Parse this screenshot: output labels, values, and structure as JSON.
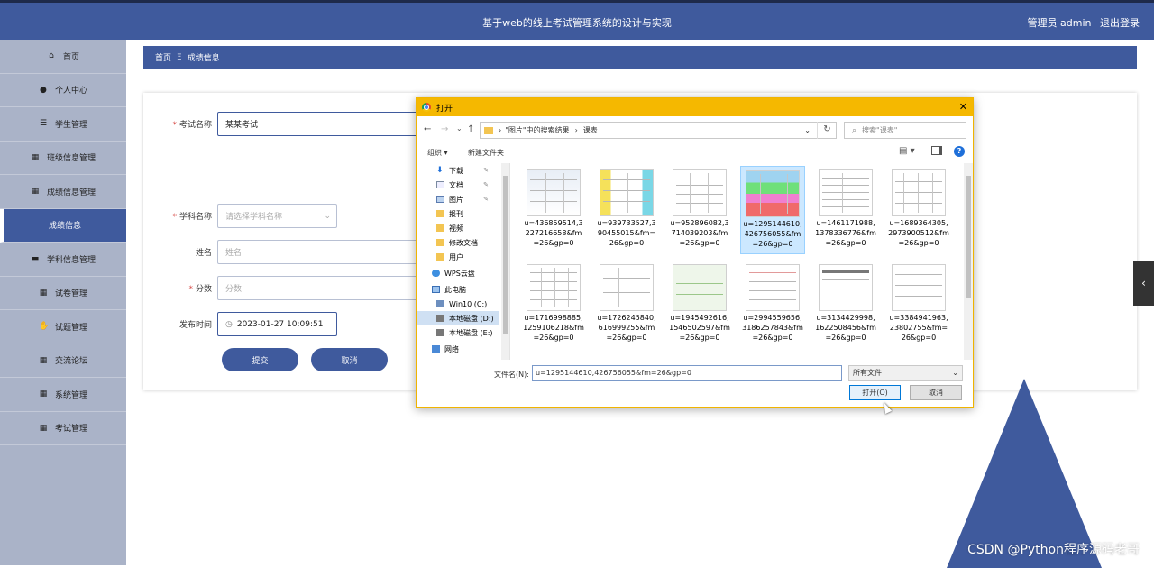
{
  "app": {
    "title": "基于web的线上考试管理系统的设计与实现",
    "user_label": "管理员 admin",
    "logout_label": "退出登录"
  },
  "sidebar": {
    "items": [
      {
        "label": "首页",
        "icon": "home-icon"
      },
      {
        "label": "个人中心",
        "icon": "user-icon"
      },
      {
        "label": "学生管理",
        "icon": "sliders-icon"
      },
      {
        "label": "班级信息管理",
        "icon": "grid-icon"
      },
      {
        "label": "成绩信息管理",
        "icon": "grid-icon"
      },
      {
        "label": "成绩信息",
        "icon": "",
        "active": true
      },
      {
        "label": "学科信息管理",
        "icon": "briefcase-icon"
      },
      {
        "label": "试卷管理",
        "icon": "grid-icon"
      },
      {
        "label": "试题管理",
        "icon": "thumbs-up-icon"
      },
      {
        "label": "交流论坛",
        "icon": "grid-icon"
      },
      {
        "label": "系统管理",
        "icon": "grid-icon"
      },
      {
        "label": "考试管理",
        "icon": "grid-icon"
      }
    ]
  },
  "breadcrumb": {
    "home": "首页",
    "sep": "Ξ",
    "current": "成绩信息"
  },
  "form": {
    "exam_name_label": "考试名称",
    "exam_name_value": "某某考试",
    "subject_label": "学科名称",
    "subject_placeholder": "请选择学科名称",
    "name_label": "姓名",
    "name_placeholder": "姓名",
    "score_label": "分数",
    "score_placeholder": "分数",
    "publish_time_label": "发布时间",
    "publish_time_value": "2023-01-27 10:09:51",
    "submit_label": "提交",
    "cancel_label": "取消"
  },
  "dialog": {
    "title": "打开",
    "path_part1": "\"图片\"中的搜索结果",
    "path_part2": "课表",
    "search_placeholder": "搜索\"课表\"",
    "organize_label": "组织 ▾",
    "new_folder_label": "新建文件夹",
    "nav_items": [
      {
        "label": "下载",
        "pinned": true,
        "icon": "download-icon"
      },
      {
        "label": "文档",
        "pinned": true,
        "icon": "document-icon"
      },
      {
        "label": "图片",
        "pinned": true,
        "icon": "picture-icon"
      },
      {
        "label": "报刊",
        "pinned": false,
        "icon": "folder-icon"
      },
      {
        "label": "视频",
        "pinned": false,
        "icon": "folder-icon"
      },
      {
        "label": "修改文档",
        "pinned": false,
        "icon": "folder-icon"
      },
      {
        "label": "用户",
        "pinned": false,
        "icon": "folder-icon"
      },
      {
        "label": "WPS云盘",
        "pinned": false,
        "icon": "cloud-icon"
      },
      {
        "label": "此电脑",
        "pinned": false,
        "icon": "computer-icon"
      },
      {
        "label": "Win10 (C:)",
        "pinned": false,
        "icon": "drive-icon"
      },
      {
        "label": "本地磁盘 (D:)",
        "pinned": false,
        "icon": "drive-icon",
        "selected": true
      },
      {
        "label": "本地磁盘 (E:)",
        "pinned": false,
        "icon": "drive-icon"
      },
      {
        "label": "网络",
        "pinned": false,
        "icon": "network-icon"
      }
    ],
    "files": [
      {
        "name": "u=436859514,3227216658&fm=26&gp=0"
      },
      {
        "name": "u=939733527,390455015&fm=26&gp=0"
      },
      {
        "name": "u=952896082,3714039203&fm=26&gp=0"
      },
      {
        "name": "u=1295144610,426756055&fm=26&gp=0",
        "selected": true
      },
      {
        "name": "u=1461171988,1378336776&fm=26&gp=0"
      },
      {
        "name": "u=1689364305,2973900512&fm=26&gp=0"
      },
      {
        "name": "u=1716998885,1259106218&fm=26&gp=0"
      },
      {
        "name": "u=1726245840,616999255&fm=26&gp=0"
      },
      {
        "name": "u=1945492616,1546502597&fm=26&gp=0"
      },
      {
        "name": "u=2994559656,3186257843&fm=26&gp=0"
      },
      {
        "name": "u=3134429998,1622508456&fm=26&gp=0"
      },
      {
        "name": "u=3384941963,23802755&fm=26&gp=0"
      }
    ],
    "filename_label": "文件名(N):",
    "filename_value": "u=1295144610,426756055&fm=26&gp=0",
    "filetype_value": "所有文件",
    "open_label": "打开(O)",
    "cancel_label": "取消"
  },
  "watermark": "CSDN @Python程序源码老哥"
}
